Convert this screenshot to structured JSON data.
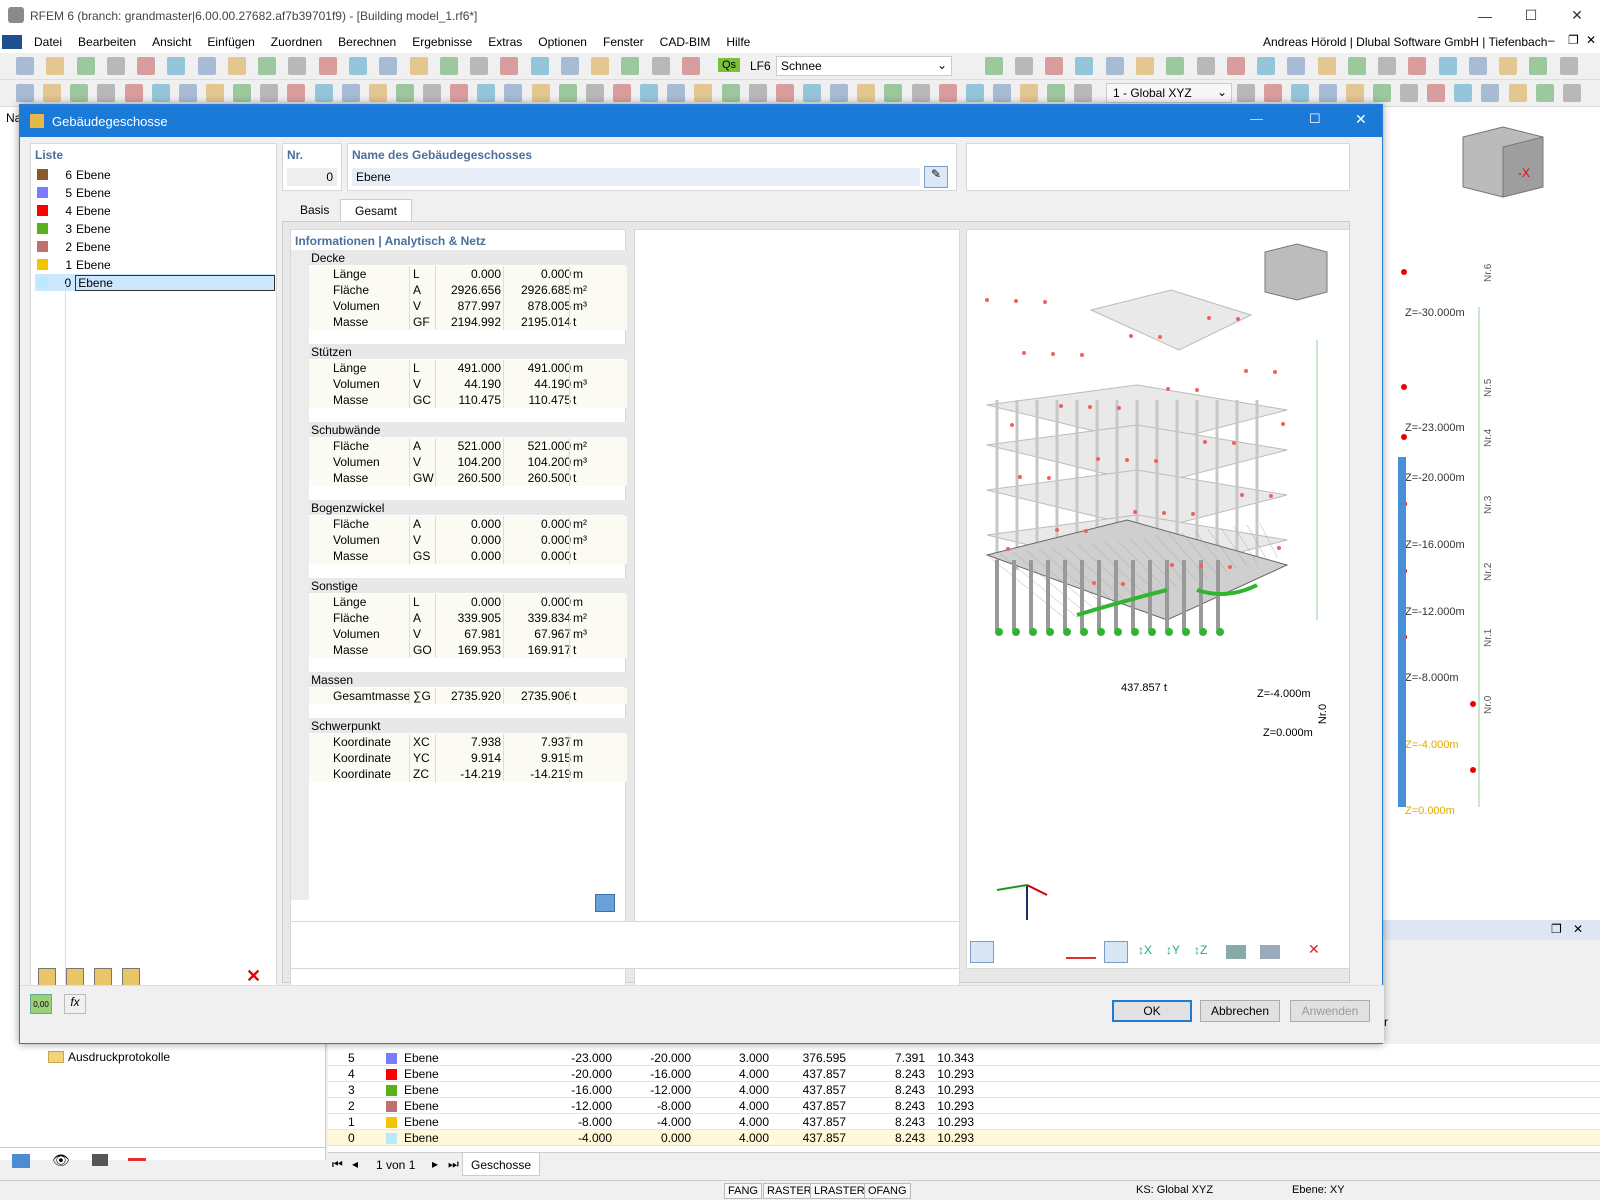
{
  "app": {
    "title": "RFEM 6 (branch: grandmaster|6.00.00.27682.af7b39701f9) - [Building model_1.rf6*]"
  },
  "menu": [
    "Datei",
    "Bearbeiten",
    "Ansicht",
    "Einfügen",
    "Zuordnen",
    "Berechnen",
    "Ergebnisse",
    "Extras",
    "Optionen",
    "Fenster",
    "CAD-BIM",
    "Hilfe"
  ],
  "user": "Andreas Hörold | Dlubal Software GmbH | Tiefenbach",
  "toolbar": {
    "lc_badge": "Qs",
    "lc_id": "LF6",
    "lc_name": "Schnee",
    "coord_system": "1 - Global XYZ"
  },
  "dialog": {
    "title": "Gebäudegeschosse",
    "list_header": "Liste",
    "list": [
      {
        "nr": "6",
        "name": "Ebene",
        "color": "#8b5a2b"
      },
      {
        "nr": "5",
        "name": "Ebene",
        "color": "#7b7bff"
      },
      {
        "nr": "4",
        "name": "Ebene",
        "color": "#ff0000"
      },
      {
        "nr": "3",
        "name": "Ebene",
        "color": "#58b11c"
      },
      {
        "nr": "2",
        "name": "Ebene",
        "color": "#c07070"
      },
      {
        "nr": "1",
        "name": "Ebene",
        "color": "#f5c400"
      },
      {
        "nr": "0",
        "name": "Ebene",
        "color": "#b7e9ff"
      }
    ],
    "nr_label": "Nr.",
    "nr_value": "0",
    "name_label": "Name des Gebäudegeschosses",
    "name_value": "Ebene",
    "tabs": [
      "Basis",
      "Gesamt"
    ],
    "info_header": "Informationen | Analytisch & Netz",
    "sections": [
      {
        "title": "Decke",
        "rows": [
          [
            "Länge",
            "L",
            "0.000",
            "0.000",
            "m"
          ],
          [
            "Fläche",
            "A",
            "2926.656",
            "2926.685",
            "m²"
          ],
          [
            "Volumen",
            "V",
            "877.997",
            "878.005",
            "m³"
          ],
          [
            "Masse",
            "GF",
            "2194.992",
            "2195.014",
            "t"
          ]
        ]
      },
      {
        "title": "Stützen",
        "rows": [
          [
            "Länge",
            "L",
            "491.000",
            "491.000",
            "m"
          ],
          [
            "Volumen",
            "V",
            "44.190",
            "44.190",
            "m³"
          ],
          [
            "Masse",
            "GC",
            "110.475",
            "110.475",
            "t"
          ]
        ]
      },
      {
        "title": "Schubwände",
        "rows": [
          [
            "Fläche",
            "A",
            "521.000",
            "521.000",
            "m²"
          ],
          [
            "Volumen",
            "V",
            "104.200",
            "104.200",
            "m³"
          ],
          [
            "Masse",
            "GW",
            "260.500",
            "260.500",
            "t"
          ]
        ]
      },
      {
        "title": "Bogenzwickel",
        "rows": [
          [
            "Fläche",
            "A",
            "0.000",
            "0.000",
            "m²"
          ],
          [
            "Volumen",
            "V",
            "0.000",
            "0.000",
            "m³"
          ],
          [
            "Masse",
            "GS",
            "0.000",
            "0.000",
            "t"
          ]
        ]
      },
      {
        "title": "Sonstige",
        "rows": [
          [
            "Länge",
            "L",
            "0.000",
            "0.000",
            "m"
          ],
          [
            "Fläche",
            "A",
            "339.905",
            "339.834",
            "m²"
          ],
          [
            "Volumen",
            "V",
            "67.981",
            "67.967",
            "m³"
          ],
          [
            "Masse",
            "GO",
            "169.953",
            "169.917",
            "t"
          ]
        ]
      },
      {
        "title": "Massen",
        "rows": [
          [
            "Gesamtmasse",
            "∑G",
            "2735.920",
            "2735.906",
            "t"
          ]
        ]
      },
      {
        "title": "Schwerpunkt",
        "rows": [
          [
            "Koordinate",
            "XC",
            "7.938",
            "7.937",
            "m"
          ],
          [
            "Koordinate",
            "YC",
            "9.914",
            "9.915",
            "m"
          ],
          [
            "Koordinate",
            "ZC",
            "-14.219",
            "-14.219",
            "m"
          ]
        ]
      }
    ],
    "preview": {
      "mass_label": "437.857 t",
      "z1": "Z=-4.000m",
      "z0": "Z=0.000m",
      "level": "Nr.0",
      "axis_x": "X",
      "axis_y": "Y",
      "axis_z": "Z"
    },
    "buttons": {
      "ok": "OK",
      "cancel": "Abbrechen",
      "apply": "Anwenden"
    }
  },
  "background": {
    "nav_label": "Na",
    "folder": "Ausdruckprotokolle",
    "levels": [
      {
        "z": "Z=-30.000m",
        "nr": "Nr.6"
      },
      {
        "z": "Z=-23.000m",
        "nr": "Nr.5"
      },
      {
        "z": "Z=-20.000m",
        "nr": "Nr.4"
      },
      {
        "z": "Z=-16.000m",
        "nr": "Nr.3"
      },
      {
        "z": "Z=-12.000m",
        "nr": "Nr.2"
      },
      {
        "z": "Z=-8.000m",
        "nr": "Nr.1"
      },
      {
        "z": "Z=-4.000m",
        "nr": "Nr.0"
      },
      {
        "z": "Z=0.000m",
        "nr": ""
      }
    ],
    "table_rows": [
      {
        "nr": "5",
        "color": "#7b7bff",
        "name": "Ebene",
        "c1": "-23.000",
        "c2": "-20.000",
        "c3": "3.000",
        "c4": "376.595",
        "c5": "7.391",
        "c6": "10.343"
      },
      {
        "nr": "4",
        "color": "#ff0000",
        "name": "Ebene",
        "c1": "-20.000",
        "c2": "-16.000",
        "c3": "4.000",
        "c4": "437.857",
        "c5": "8.243",
        "c6": "10.293"
      },
      {
        "nr": "3",
        "color": "#58b11c",
        "name": "Ebene",
        "c1": "-16.000",
        "c2": "-12.000",
        "c3": "4.000",
        "c4": "437.857",
        "c5": "8.243",
        "c6": "10.293"
      },
      {
        "nr": "2",
        "color": "#c07070",
        "name": "Ebene",
        "c1": "-12.000",
        "c2": "-8.000",
        "c3": "4.000",
        "c4": "437.857",
        "c5": "8.243",
        "c6": "10.293"
      },
      {
        "nr": "1",
        "color": "#f5c400",
        "name": "Ebene",
        "c1": "-8.000",
        "c2": "-4.000",
        "c3": "4.000",
        "c4": "437.857",
        "c5": "8.243",
        "c6": "10.293"
      },
      {
        "nr": "0",
        "color": "#b7e9ff",
        "name": "Ebene",
        "c1": "-4.000",
        "c2": "0.000",
        "c3": "4.000",
        "c4": "437.857",
        "c5": "8.243",
        "c6": "10.293"
      }
    ],
    "pager": "1 von 1",
    "sheet_tab": "Geschosse",
    "col_fragment": "r"
  },
  "status": {
    "snap": "FANG",
    "grid": "RASTER",
    "lgrid": "LRASTER",
    "ofang": "OFANG",
    "cs": "KS: Global XYZ",
    "plane": "Ebene: XY"
  }
}
